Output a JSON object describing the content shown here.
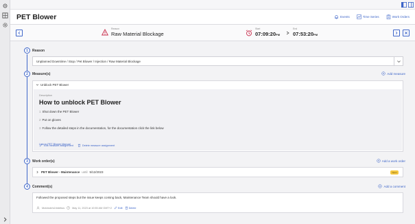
{
  "app": {
    "title": "PET Blower",
    "header_links": [
      {
        "label": "Events",
        "icon": "bell-icon"
      },
      {
        "label": "Time Series",
        "icon": "chart-icon"
      },
      {
        "label": "Work Orders",
        "icon": "clipboard-icon"
      }
    ]
  },
  "event": {
    "reason_caption": "Reason",
    "reason_value": "Raw Material Blockage",
    "start_caption": "Start",
    "start_time": "07:09:20",
    "start_suffix": "PM",
    "end_caption": "End",
    "end_time": "07:53:20",
    "end_suffix": "PM"
  },
  "sections": {
    "reason": {
      "step": "1",
      "title": "Reason",
      "value": "Unplanned Downtime / Stop / Pet Blower / Injection / Raw Material Blockage"
    },
    "measures": {
      "step": "2",
      "title": "Measure(s)",
      "add_label": "Add measure",
      "item_title": "Unblock PET Blower",
      "description_caption": "Description",
      "description_title": "How to unblock PET Blower",
      "steps": [
        {
          "num": "1",
          "text": "Shut down the PET Blower"
        },
        {
          "num": "2",
          "text": "Put on gloves"
        },
        {
          "num": "3",
          "text": "Follow the detailed steps in the documentation, for the documentation click the link below"
        }
      ],
      "link_label": "Link to PET Blower Manual",
      "edit_label": "Edit measure assignment",
      "delete_label": "Delete measure assignment"
    },
    "work_orders": {
      "step": "3",
      "title": "Work order(s)",
      "add_label": "Add a work order",
      "item_title": "PET Blower - Maintenance",
      "until_label": "until",
      "date": "5/12/2023",
      "badge": "Open"
    },
    "comments": {
      "step": "4",
      "title": "Comment(s)",
      "add_label": "Add a comment",
      "text": "Followed the proposed steps but the issue keeps coming back, Maintenance Team should have a look.",
      "author": "Mckinsle/s1hidebus",
      "timestamp": "May 11, 2023 at 10:55 AM GMT+2",
      "edit_label": "Edit",
      "delete_label": "Delete"
    }
  },
  "colors": {
    "accent": "#3c64c8",
    "alert": "#c82d4b",
    "badge": "#f5c842"
  }
}
